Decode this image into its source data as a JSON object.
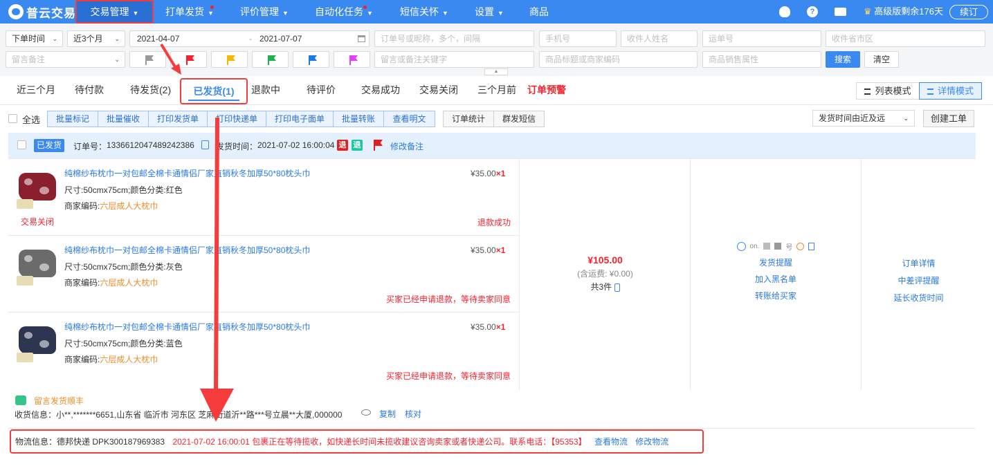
{
  "app": {
    "name": "普云交易"
  },
  "nav": {
    "items": [
      {
        "label": "交易管理"
      },
      {
        "label": "打单发货"
      },
      {
        "label": "评价管理"
      },
      {
        "label": "自动化任务"
      },
      {
        "label": "短信关怀"
      },
      {
        "label": "设置"
      },
      {
        "label": "商品"
      }
    ],
    "premium": "高级版剩余176天",
    "renew": "续订",
    "help": "?"
  },
  "filters": {
    "time_type": "下单时间",
    "time_range": "近3个月",
    "date_start": "2021-04-07",
    "date_sep": "-",
    "date_end": "2021-07-07",
    "order_placeholder": "订单号或昵称，多个，间隔",
    "phone_placeholder": "手机号",
    "receiver_placeholder": "收件人姓名",
    "waybill_placeholder": "运单号",
    "region_placeholder": "收件省市区",
    "remark_type": "留言备注",
    "remark_keyword_placeholder": "留言或备注关键字",
    "product_placeholder": "商品标题或商家编码",
    "attr_placeholder": "商品销售属性",
    "search": "搜索",
    "clear": "清空",
    "flags": [
      {
        "color": "#999999"
      },
      {
        "color": "#f5222d"
      },
      {
        "color": "#f5b700"
      },
      {
        "color": "#20b24a"
      },
      {
        "color": "#1f7ae0"
      },
      {
        "color": "#e040fb"
      }
    ]
  },
  "tabs": [
    {
      "label": "近三个月"
    },
    {
      "label": "待付款"
    },
    {
      "label": "待发货(2)"
    },
    {
      "label": "已发货(1)"
    },
    {
      "label": "退款中"
    },
    {
      "label": "待评价"
    },
    {
      "label": "交易成功"
    },
    {
      "label": "交易关闭"
    },
    {
      "label": "三个月前"
    },
    {
      "label": "订单预警"
    }
  ],
  "view_modes": {
    "list": "列表模式",
    "detail": "详情模式"
  },
  "toolbar": {
    "select_all": "全选",
    "batch": [
      "批量标记",
      "批量催收",
      "打印发货单",
      "打印快递单",
      "打印电子面单",
      "批量转账",
      "查看明文"
    ],
    "stats": "订单统计",
    "sms": "群发短信",
    "sort": "发货时间由近及远",
    "ticket": "创建工单"
  },
  "order": {
    "status_badge": "已发货",
    "order_no_label": "订单号：",
    "order_no": "1336612047489242386",
    "ship_time_label": "发货时间：",
    "ship_time": "2021-07-02 16:00:04",
    "tag_refund1": "退",
    "tag_refund2": "退",
    "edit_remark": "修改备注",
    "items": [
      {
        "title": "纯棉纱布枕巾一对包邮全棉卡通情侣厂家直销秋冬加厚50*80枕头巾",
        "spec": "尺寸:50cmx75cm;颜色分类:红色",
        "code_label": "商家编码:",
        "code": "六层成人大枕巾",
        "price": "¥35.00",
        "qty": "×1",
        "status": "退款成功",
        "note": "交易关闭",
        "color": "#8a1f2e"
      },
      {
        "title": "纯棉纱布枕巾一对包邮全棉卡通情侣厂家直销秋冬加厚50*80枕头巾",
        "spec": "尺寸:50cmx75cm;颜色分类:灰色",
        "code_label": "商家编码:",
        "code": "六层成人大枕巾",
        "price": "¥35.00",
        "qty": "×1",
        "status": "买家已经申请退款，等待卖家同意",
        "note": "",
        "color": "#6b6b6b"
      },
      {
        "title": "纯棉纱布枕巾一对包邮全棉卡通情侣厂家直销秋冬加厚50*80枕头巾",
        "spec": "尺寸:50cmx75cm;颜色分类:蓝色",
        "code_label": "商家编码:",
        "code": "六层成人大枕巾",
        "price": "¥35.00",
        "qty": "×1",
        "status": "买家已经申请退款，等待卖家同意",
        "note": "",
        "color": "#2d3550"
      }
    ],
    "total": "¥105.00",
    "shipping": "(含运费: ¥0.00)",
    "count": "共3件",
    "buyer_name": "on.",
    "buyer_tag": "号",
    "buyer_actions": [
      "发货提醒",
      "加入黑名单",
      "转账给买家"
    ],
    "order_actions": [
      "订单详情",
      "中差评提醒",
      "延长收货时间"
    ],
    "message_label": "留言发货顺丰",
    "address": "收货信息：小**,*******6651,山东省 临沂市 河东区 芝麻街道沂**路***号立晨**大厦,000000",
    "copy": "复制",
    "verify": "核对",
    "logistics_label": "物流信息：德邦快递 DPK300187969383",
    "logistics_detail": "2021-07-02 16:00:01 包裹正在等待揽收，如快递长时间未揽收建议咨询卖家或者快递公司。联系电话：【95353】",
    "view_logistics": "查看物流",
    "edit_logistics": "修改物流"
  }
}
